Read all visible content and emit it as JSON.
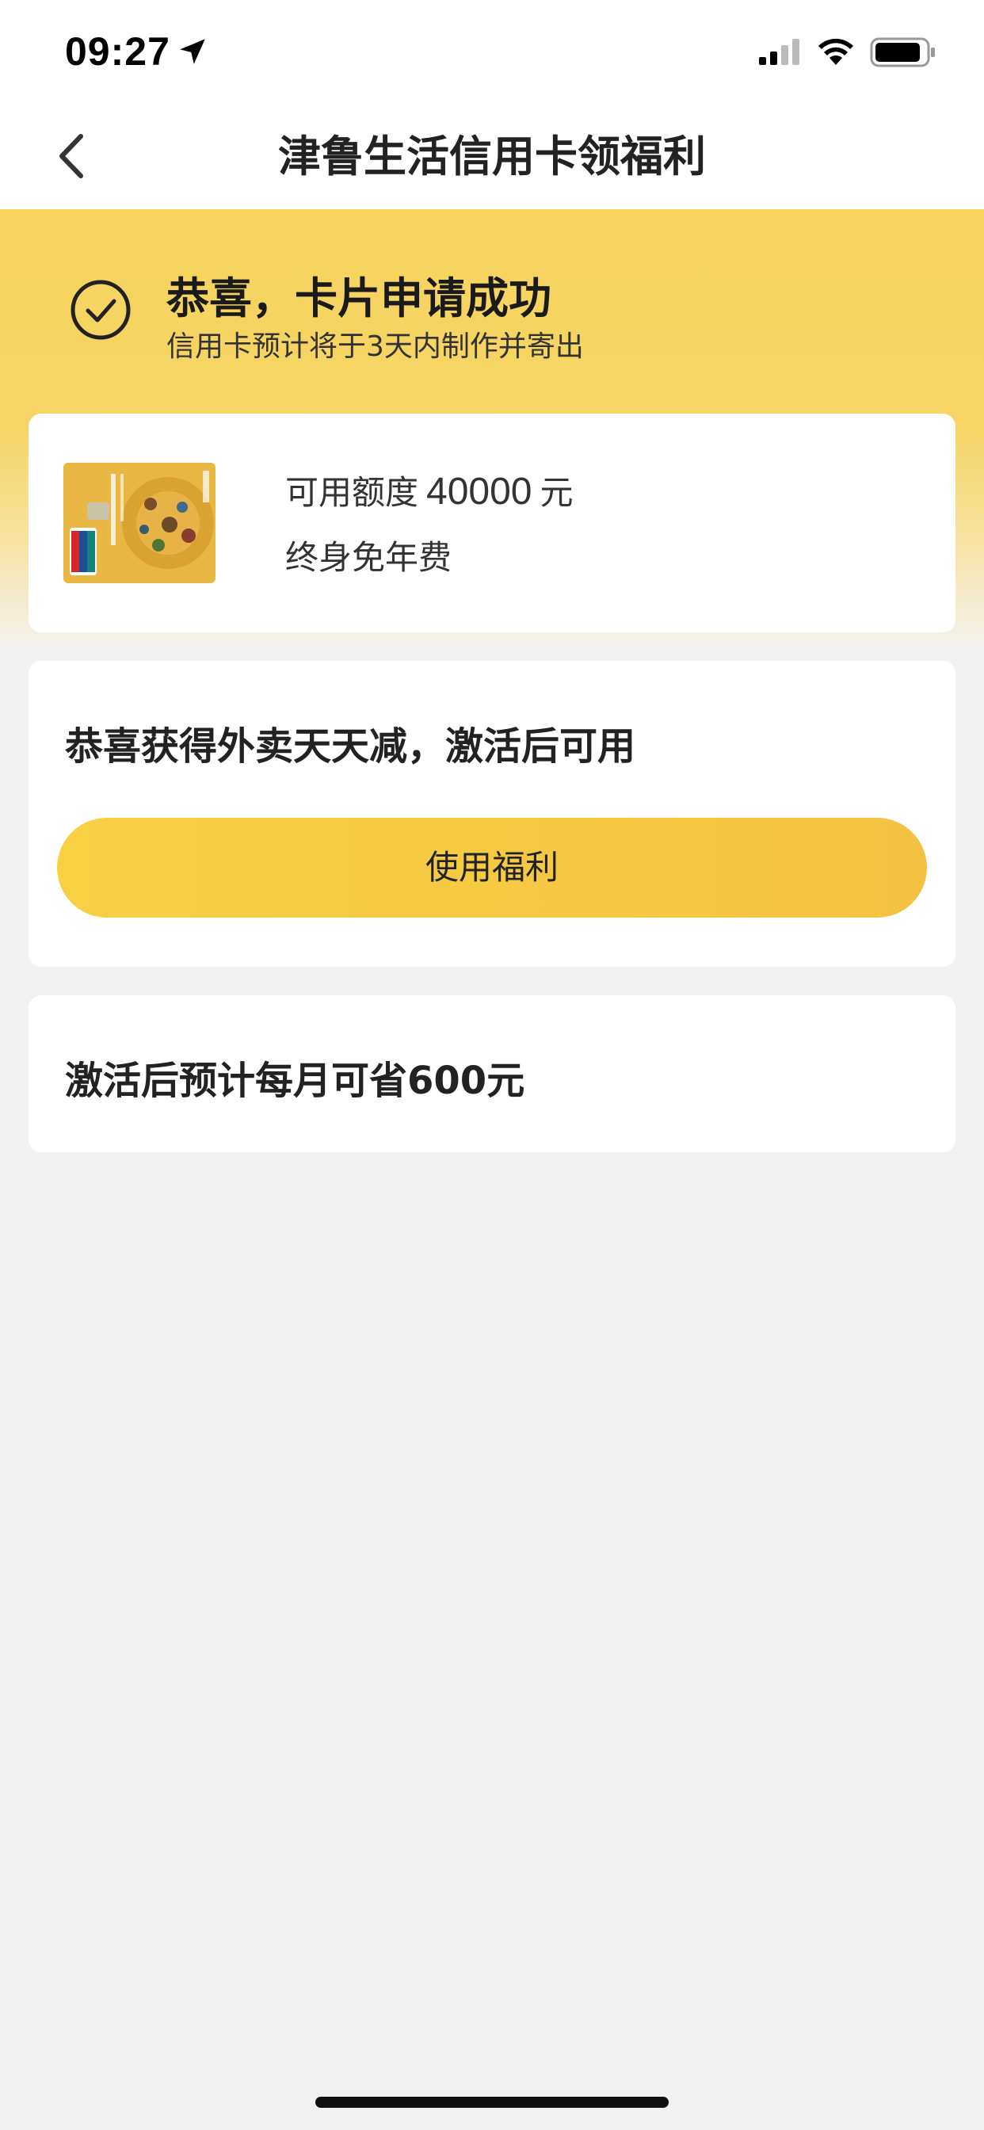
{
  "status_bar": {
    "time": "09:27",
    "icons": [
      "location-arrow-icon",
      "signal-icon",
      "wifi-icon",
      "battery-icon"
    ]
  },
  "nav": {
    "back_icon": "chevron-left-icon",
    "title": "津鲁生活信用卡领福利"
  },
  "success": {
    "icon": "check-circle-icon",
    "title": "恭喜，卡片申请成功",
    "subtitle": "信用卡预计将于3天内制作并寄出"
  },
  "card": {
    "credit_prefix": "可用额度",
    "credit_amount": "40000",
    "credit_unit": "元",
    "fee_text": "终身免年费",
    "card_image_icon": "credit-card-image"
  },
  "benefit": {
    "title": "恭喜获得外卖天天减，激活后可用",
    "button_label": "使用福利"
  },
  "savings": {
    "text": "激活后预计每月可省600元"
  },
  "colors": {
    "accent_yellow": "#f7d45e",
    "button_yellow": "#f6c843",
    "background": "#f2f2f2"
  }
}
